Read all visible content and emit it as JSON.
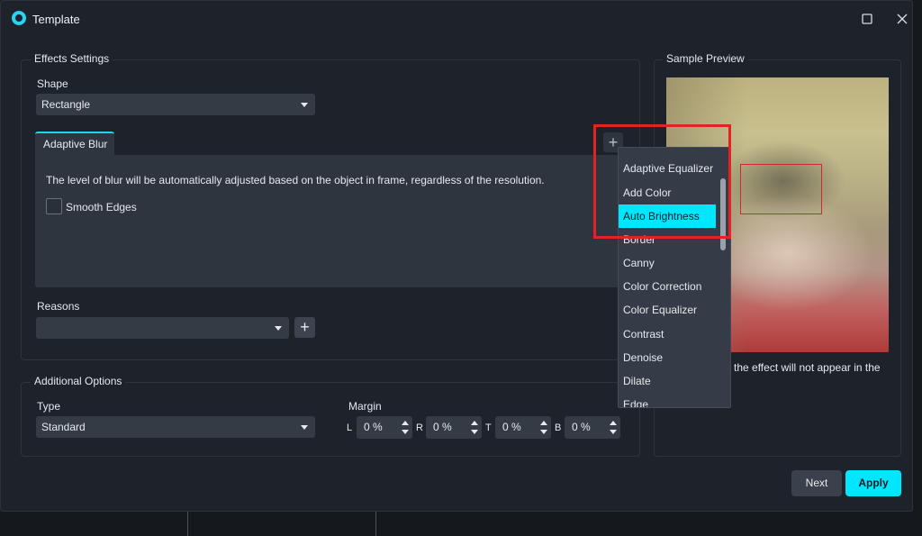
{
  "window": {
    "title": "Template"
  },
  "effects_settings": {
    "group_title": "Effects Settings",
    "shape_label": "Shape",
    "shape_value": "Rectangle",
    "tab_label": "Adaptive Blur",
    "description": "The level of blur will be automatically adjusted based on the object in frame, regardless of the resolution.",
    "smooth_edges_label": "Smooth Edges",
    "reasons_label": "Reasons",
    "reasons_value": "",
    "add_effect_symbol": "+",
    "add_reason_symbol": "+"
  },
  "effect_menu": {
    "items": [
      "Adaptive Equalizer",
      "Add Color",
      "Auto Brightness",
      "Border",
      "Canny",
      "Color Correction",
      "Color Equalizer",
      "Contrast",
      "Denoise",
      "Dilate",
      "Edge"
    ],
    "selected": "Auto Brightness"
  },
  "additional_options": {
    "group_title": "Additional Options",
    "type_label": "Type",
    "type_value": "Standard",
    "margin_label": "Margin",
    "margins": [
      {
        "letter": "L",
        "value": "0 %"
      },
      {
        "letter": "R",
        "value": "0 %"
      },
      {
        "letter": "T",
        "value": "0 %"
      },
      {
        "letter": "B",
        "value": "0 %"
      }
    ]
  },
  "sample_preview": {
    "group_title": "Sample Preview",
    "note": "the effect will not appear in the"
  },
  "footer": {
    "next_label": "Next",
    "apply_label": "Apply"
  },
  "colors": {
    "accent": "#00e6ff",
    "highlight": "#e02424",
    "background": "#1e232b"
  },
  "icons": {
    "logo": "app-logo-icon",
    "maximize": "maximize-icon",
    "close": "close-icon"
  }
}
